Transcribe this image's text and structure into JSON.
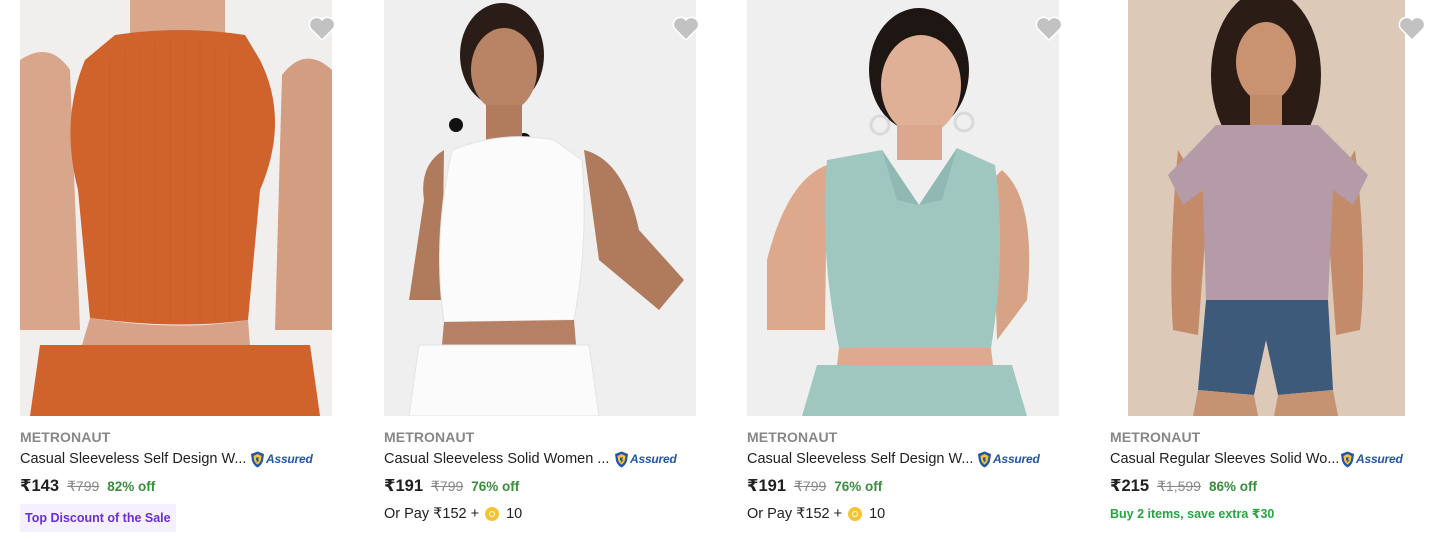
{
  "products": [
    {
      "brand": "METRONAUT",
      "title": "Casual Sleeveless Self Design W...",
      "assured_label": "Assured",
      "price": "₹143",
      "mrp": "₹799",
      "discount": "82% off",
      "badge": "Top Discount of the Sale",
      "garment_color": "#d0622c",
      "wishlisted": false
    },
    {
      "brand": "METRONAUT",
      "title": "Casual Sleeveless Solid Women ...",
      "assured_label": "Assured",
      "price": "₹191",
      "mrp": "₹799",
      "discount": "76% off",
      "pay_text": "Or Pay ₹152 +",
      "supercoins": "10",
      "garment_color": "#fbfbfb",
      "wishlisted": false
    },
    {
      "brand": "METRONAUT",
      "title": "Casual Sleeveless Self Design W...",
      "assured_label": "Assured",
      "price": "₹191",
      "mrp": "₹799",
      "discount": "76% off",
      "pay_text": "Or Pay ₹152 +",
      "supercoins": "10",
      "garment_color": "#9fc7c0",
      "wishlisted": false
    },
    {
      "brand": "METRONAUT",
      "title": "Casual Regular Sleeves Solid Wo...",
      "assured_label": "Assured",
      "price": "₹215",
      "mrp": "₹1,599",
      "discount": "86% off",
      "offer": "Buy 2 items, save extra ₹30",
      "garment_color": "#b59aa7",
      "wishlisted": false
    }
  ],
  "colors": {
    "brand_text": "#878787",
    "discount_green": "#388e3c",
    "offer_green": "#26a541",
    "assured_blue": "#2455a6",
    "badge_purple": "#6a2fd6",
    "badge_bg": "#f5f0ff",
    "wishlist_heart": "#c2c2c2",
    "supercoin": "#f7c331"
  },
  "icons": {
    "wishlist": "heart-icon",
    "assured": "flipkart-assured-shield-icon",
    "supercoin": "supercoin-icon"
  }
}
